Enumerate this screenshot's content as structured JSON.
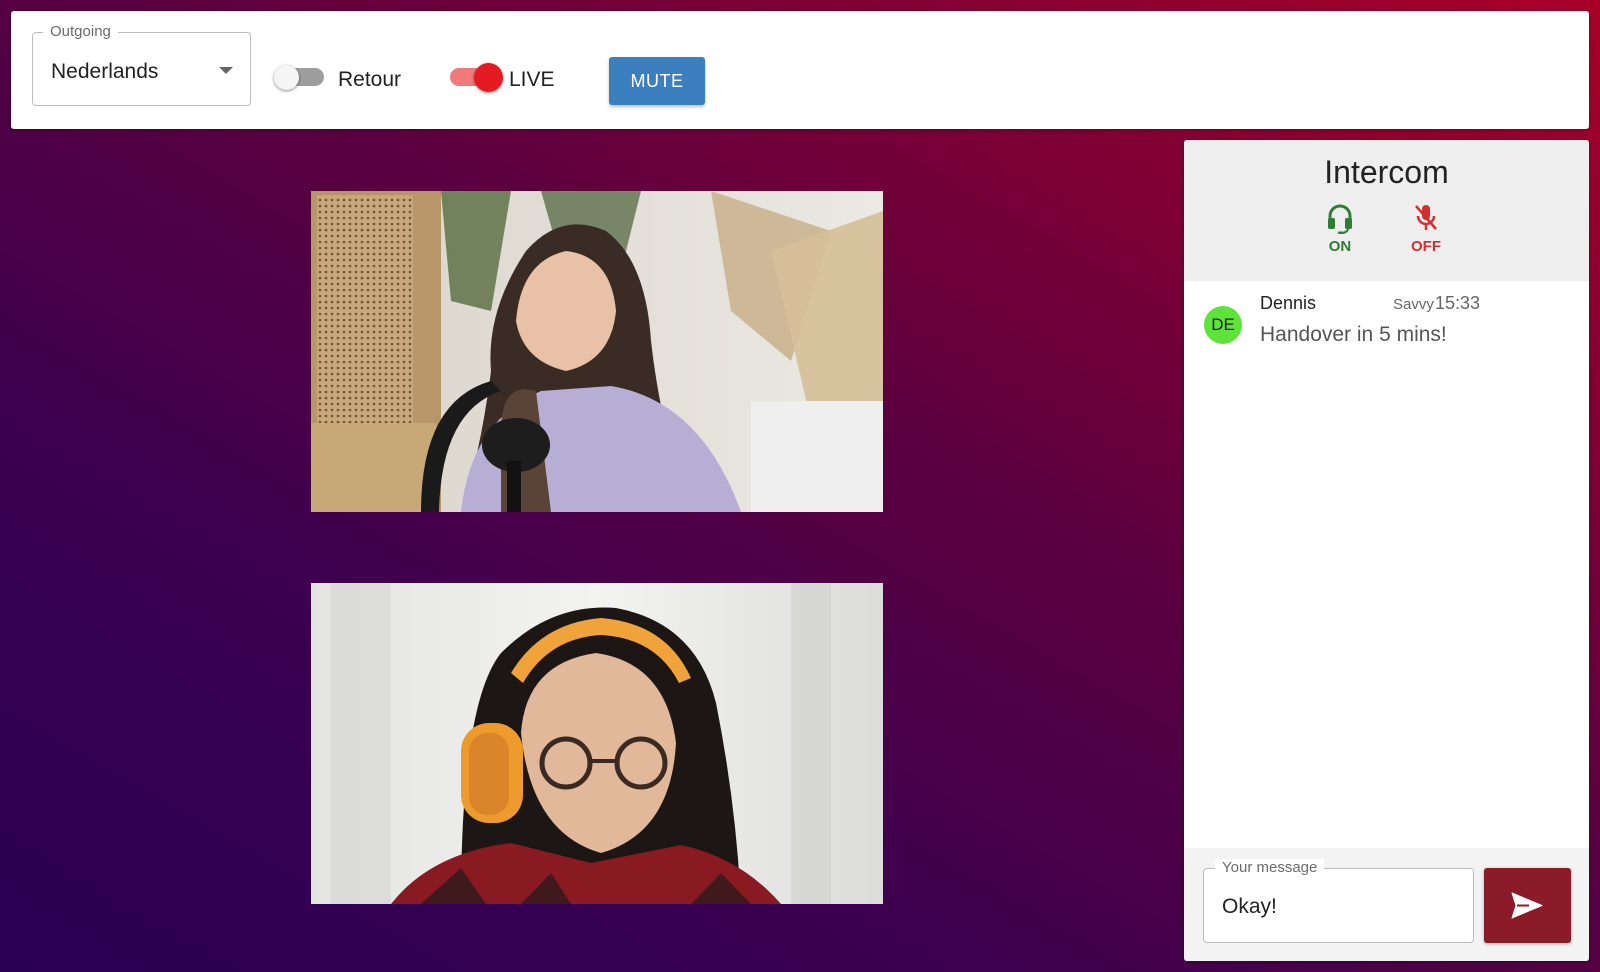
{
  "toolbar": {
    "outgoing": {
      "label": "Outgoing",
      "value": "Nederlands",
      "options": [
        "Nederlands"
      ]
    },
    "retour": {
      "label": "Retour",
      "on": false
    },
    "live": {
      "label": "LIVE",
      "on": true
    },
    "mute_label": "MUTE"
  },
  "videos": [
    {
      "name": "video-feed-1"
    },
    {
      "name": "video-feed-2"
    }
  ],
  "intercom": {
    "title": "Intercom",
    "headset": {
      "icon": "headset-icon",
      "label": "ON",
      "color": "#2e7d32"
    },
    "microphone": {
      "icon": "mic-off-icon",
      "label": "OFF",
      "color": "#d32f2f"
    },
    "messages": [
      {
        "initials": "DE",
        "name": "Dennis",
        "role": "Savvy",
        "time": "15:33",
        "text": "Handover in 5 mins!",
        "avatar_color": "#5de33a"
      }
    ],
    "composer": {
      "label": "Your message",
      "value": "Okay!",
      "send_icon": "send-icon"
    }
  },
  "colors": {
    "accent_blue": "#3c7fbf",
    "send_button": "#8c1b2a",
    "live_red": "#e51b23"
  }
}
